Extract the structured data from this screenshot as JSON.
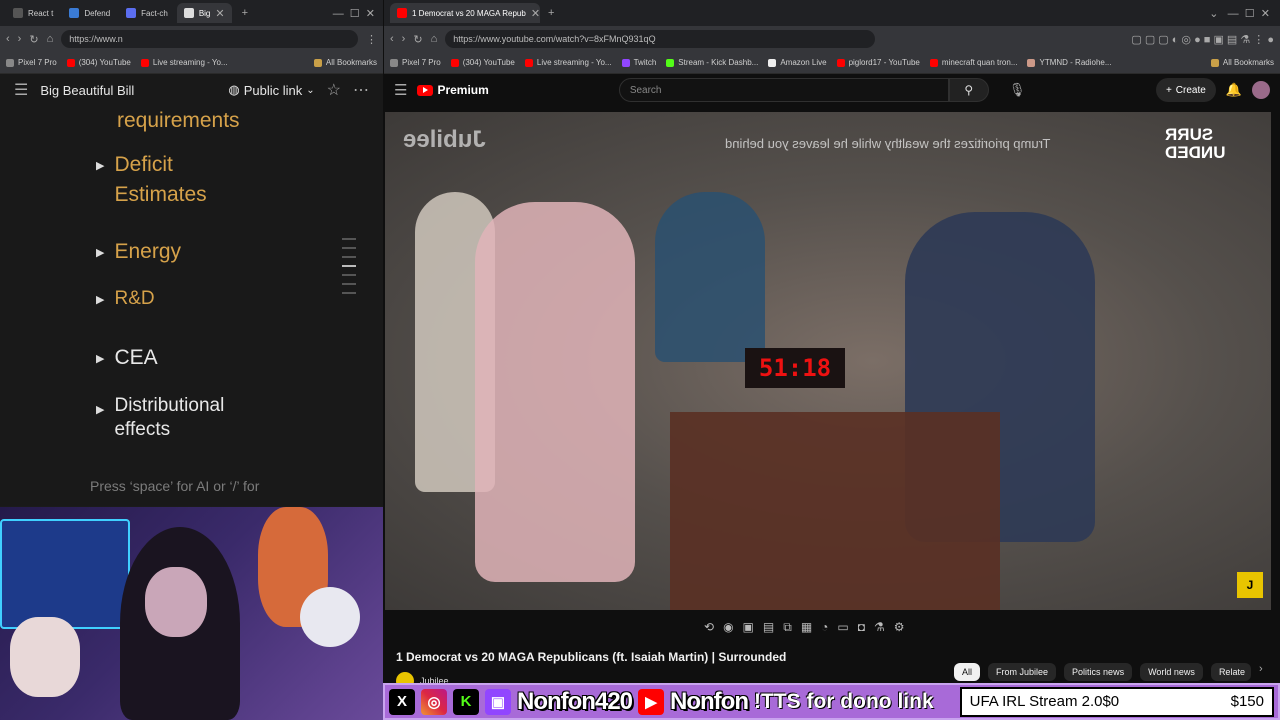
{
  "left_browser": {
    "tabs": [
      {
        "label": "React t"
      },
      {
        "label": "Defend"
      },
      {
        "label": "Fact-ch"
      },
      {
        "label": "Big"
      }
    ],
    "url": "https://www.n",
    "bookmarks": [
      "Pixel 7 Pro",
      "(304) YouTube",
      "Live streaming - Yo..."
    ],
    "all_bookmarks": "All Bookmarks"
  },
  "doc": {
    "title": "Big Beautiful Bill",
    "public_link": "Public link",
    "toc": [
      {
        "label": "requirements"
      },
      {
        "label": "Deficit Estimates"
      },
      {
        "label": "Energy"
      },
      {
        "label": "R&D"
      },
      {
        "label": "CEA"
      },
      {
        "label": "Distributional effects"
      }
    ],
    "hint": "Press ‘space’ for AI or ‘/’ for"
  },
  "right_browser": {
    "tab_title": "1 Democrat vs 20 MAGA Repub",
    "url": "https://www.youtube.com/watch?v=8xFMnQ931qQ",
    "bookmarks": [
      "Pixel 7 Pro",
      "(304) YouTube",
      "Live streaming - Yo...",
      "Twitch",
      "Stream - Kick Dashb...",
      "Amazon Live",
      "piglord17 - YouTube",
      "minecraft quan tron...",
      "YTMND - Radiohe..."
    ],
    "all_bookmarks": "All Bookmarks"
  },
  "youtube": {
    "brand": "Premium",
    "search_placeholder": "Search",
    "create_label": "Create",
    "video_overlay_brand": "Jubilee",
    "video_overlay_text": "Trump prioritizes the wealthy while he leaves you behind",
    "video_overlay_badge": "SURR UNDED",
    "video_clock": "51:18",
    "video_title": "1 Democrat vs 20 MAGA Republicans (ft. Isaiah Martin) | Surrounded",
    "channel": "Jubilee",
    "chips": [
      "All",
      "From Jubilee",
      "Politics news",
      "World news",
      "Relate"
    ]
  },
  "stream_overlay": {
    "handle_1": "Nonfon420",
    "handle_2": "Nonfon",
    "dono_text": "!TTS for dono link",
    "goal_label": "UFA IRL Stream 2.0",
    "goal_current": "$0",
    "goal_target": "$150"
  },
  "colors": {
    "doc_gold": "#d6a24a",
    "youtube_red": "#ff0000",
    "overlay_purple": "#a86ad8"
  }
}
